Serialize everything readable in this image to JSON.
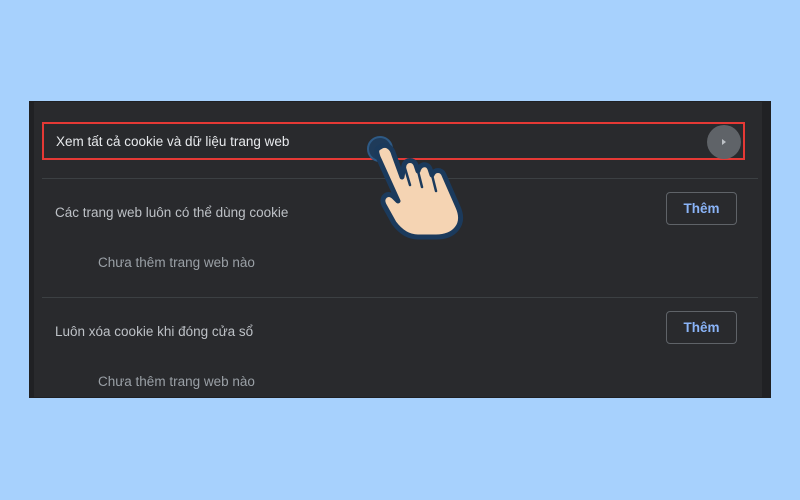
{
  "colors": {
    "page_background": "#a7d1fd",
    "panel_background": "#292a2d",
    "highlight_border": "#e53935",
    "link_blue": "#8ab4f8",
    "hand_fill": "#f5d4b3",
    "hand_outline": "#1b3a5c"
  },
  "see_all": {
    "label": "Xem tất cả cookie và dữ liệu trang web",
    "icon": "chevron-right-icon"
  },
  "sections": [
    {
      "title": "Các trang web luôn có thể dùng cookie",
      "button_label": "Thêm",
      "empty_text": "Chưa thêm trang web nào"
    },
    {
      "title": "Luôn xóa cookie khi đóng cửa sổ",
      "button_label": "Thêm",
      "empty_text": "Chưa thêm trang web nào"
    }
  ],
  "overlay": {
    "icon": "pointing-hand-icon"
  }
}
